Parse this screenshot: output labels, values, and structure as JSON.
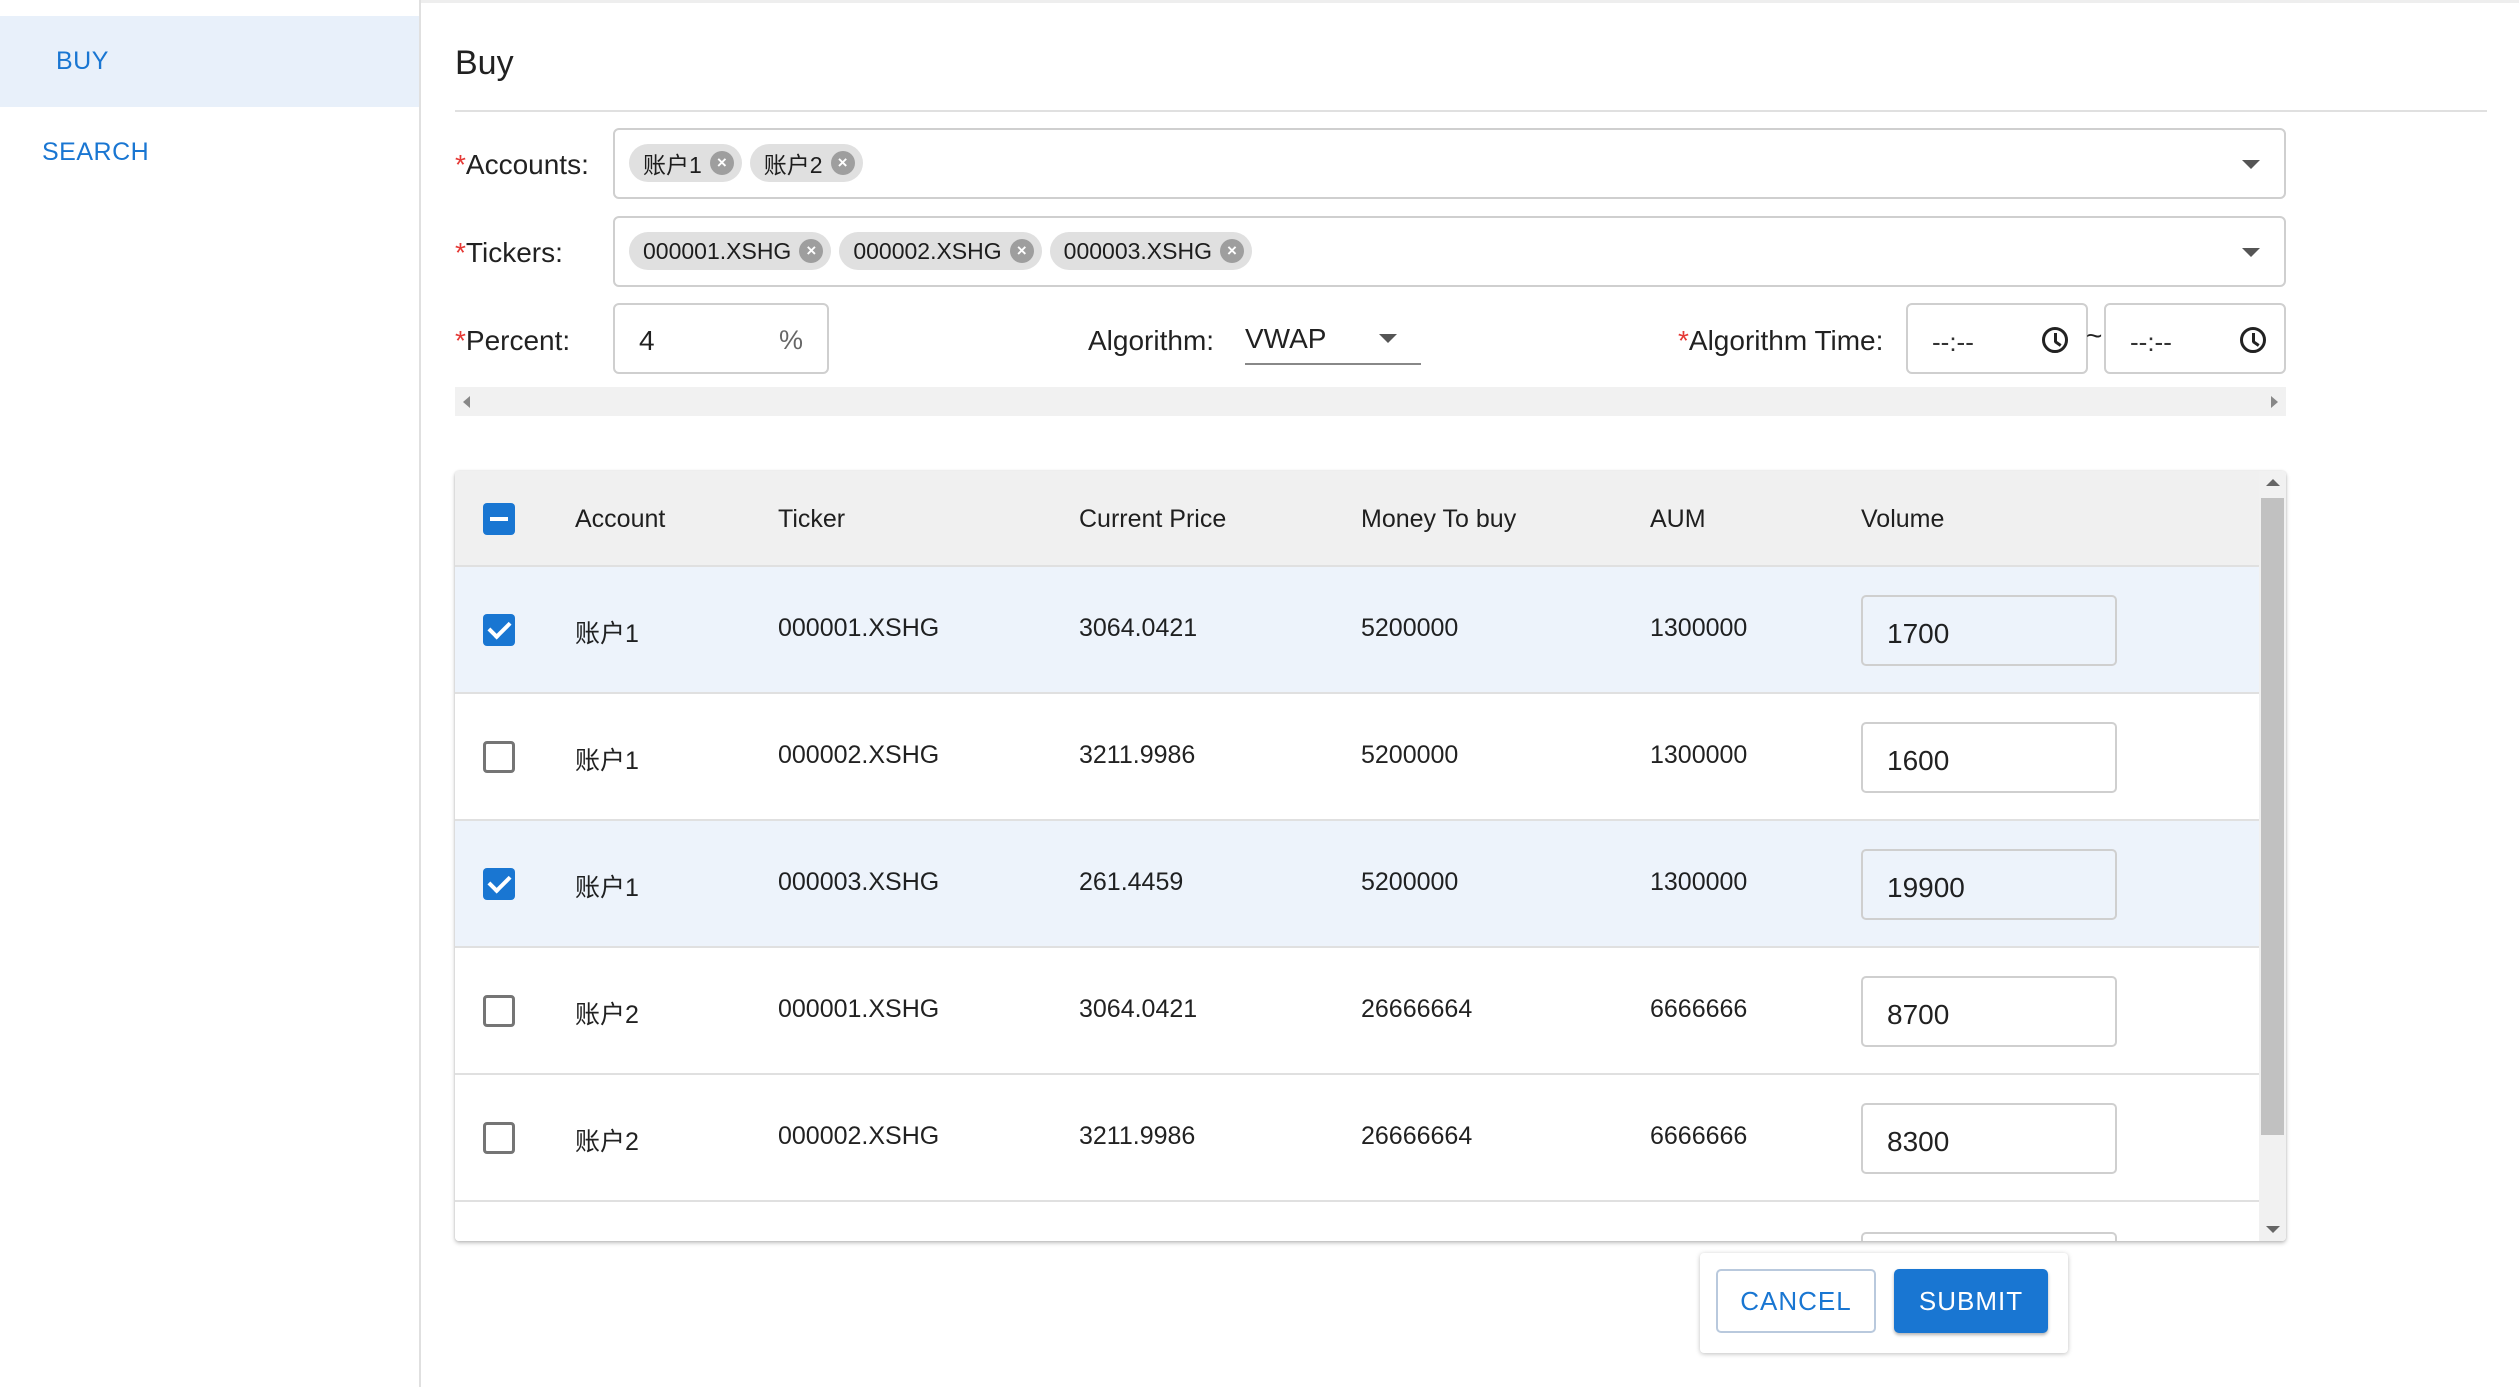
{
  "sidebar": {
    "items": [
      {
        "label": "BUY"
      },
      {
        "label": "SEARCH"
      }
    ]
  },
  "page": {
    "title": "Buy"
  },
  "form": {
    "required_mark": "*",
    "accounts": {
      "label": "Accounts:",
      "chips": [
        "账户1",
        "账户2"
      ]
    },
    "tickers": {
      "label": "Tickers:",
      "chips": [
        "000001.XSHG",
        "000002.XSHG",
        "000003.XSHG"
      ]
    },
    "percent": {
      "label": "Percent:",
      "value": "4",
      "unit": "%"
    },
    "algorithm": {
      "label": "Algorithm:",
      "value": "VWAP"
    },
    "algorithm_time": {
      "label": "Algorithm Time:",
      "start": "--:--",
      "end": "--:--",
      "separator": "~"
    }
  },
  "table": {
    "columns": [
      "Account",
      "Ticker",
      "Current Price",
      "Money To buy",
      "AUM",
      "Volume"
    ],
    "rows": [
      {
        "checked": true,
        "account": "账户1",
        "ticker": "000001.XSHG",
        "price": "3064.0421",
        "money": "5200000",
        "aum": "1300000",
        "volume": "1700"
      },
      {
        "checked": false,
        "account": "账户1",
        "ticker": "000002.XSHG",
        "price": "3211.9986",
        "money": "5200000",
        "aum": "1300000",
        "volume": "1600"
      },
      {
        "checked": true,
        "account": "账户1",
        "ticker": "000003.XSHG",
        "price": "261.4459",
        "money": "5200000",
        "aum": "1300000",
        "volume": "19900"
      },
      {
        "checked": false,
        "account": "账户2",
        "ticker": "000001.XSHG",
        "price": "3064.0421",
        "money": "26666664",
        "aum": "6666666",
        "volume": "8700"
      },
      {
        "checked": false,
        "account": "账户2",
        "ticker": "000002.XSHG",
        "price": "3211.9986",
        "money": "26666664",
        "aum": "6666666",
        "volume": "8300"
      }
    ]
  },
  "actions": {
    "cancel": "CANCEL",
    "submit": "SUBMIT"
  },
  "colors": {
    "primary": "#1976d2",
    "selected_row": "#edf3fb",
    "required": "#e53935"
  }
}
